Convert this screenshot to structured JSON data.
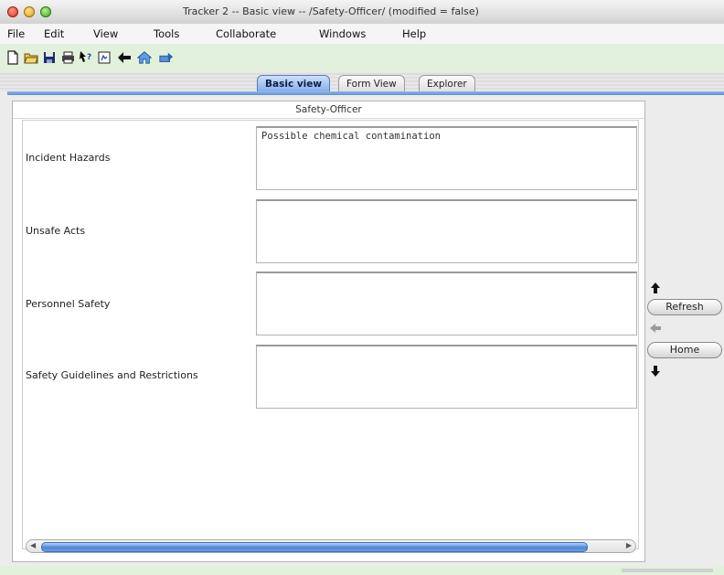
{
  "window": {
    "title": "Tracker 2 -- Basic view -- /Safety-Officer/    (modified = false)"
  },
  "menu": [
    "File",
    "Edit",
    "View",
    "Tools",
    "Collaborate",
    "Windows",
    "Help"
  ],
  "toolbar": {
    "icons": [
      "new-document-icon",
      "open-folder-icon",
      "save-disk-icon",
      "print-icon",
      "help-cursor-icon",
      "info-icon",
      "back-arrow-icon",
      "home-icon",
      "forward-icon"
    ]
  },
  "tabs": [
    {
      "label": "Basic view",
      "active": true
    },
    {
      "label": "Form View",
      "active": false
    },
    {
      "label": "Explorer",
      "active": false
    }
  ],
  "panel": {
    "title": "Safety-Officer"
  },
  "fields": [
    {
      "label": "Incident Hazards",
      "value": "Possible chemical contamination"
    },
    {
      "label": "Unsafe Acts",
      "value": ""
    },
    {
      "label": "Personnel Safety",
      "value": ""
    },
    {
      "label": "Safety Guidelines and Restrictions",
      "value": ""
    }
  ],
  "side_nav": {
    "refresh_label": "Refresh",
    "home_label": "Home"
  }
}
